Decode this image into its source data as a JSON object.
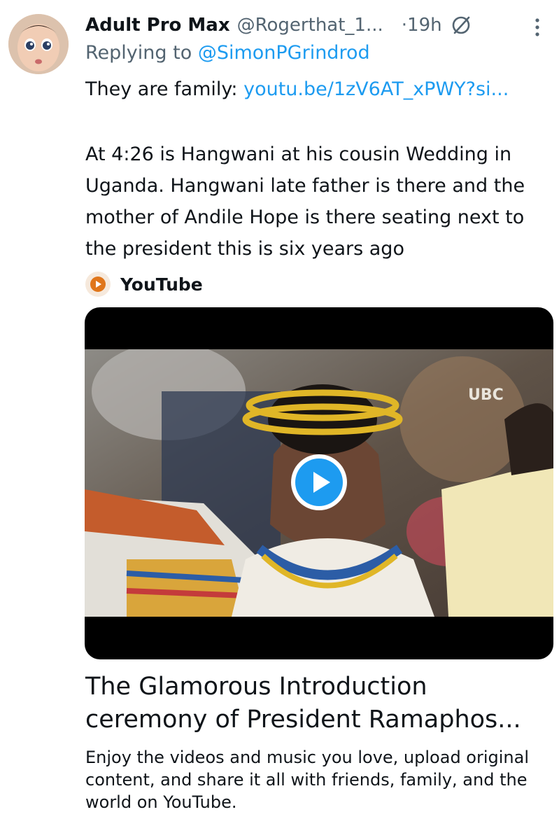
{
  "tweet": {
    "display_name": "Adult Pro Max",
    "handle": "@Rogerthat_1...",
    "time": "·19h",
    "replying_prefix": "Replying to",
    "replying_to": "@SimonPGrindrod",
    "intro_text": "They are family:",
    "intro_link": "youtu.be/1zV6AT_xPWY?si...",
    "body": "At 4:26 is Hangwani at his cousin Wedding in Uganda. Hangwani late father is there and the mother of Andile Hope is there seating next to the president this is six years ago",
    "avatar_icon": "baby-avatar",
    "edit_icon": "edited-icon",
    "more_icon": "more-options-icon"
  },
  "card": {
    "source": "YouTube",
    "source_icon": "youtube-icon",
    "watermark": "UBC",
    "play_icon": "play-icon",
    "title": "The Glamorous Introduction ceremony of President Ramaphos...",
    "description": "Enjoy the videos and music you love, upload original content, and share it all with friends, family, and the world on YouTube."
  },
  "colors": {
    "link": "#1d9bf0",
    "secondary_text": "#536471",
    "play_button": "#1d9bf0"
  }
}
